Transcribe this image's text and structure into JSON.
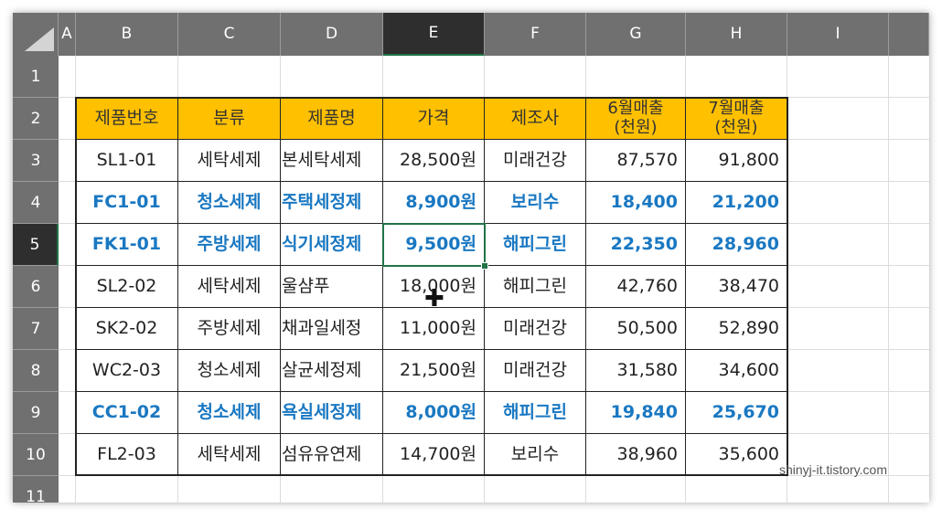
{
  "columns": [
    "A",
    "B",
    "C",
    "D",
    "E",
    "F",
    "G",
    "H",
    "I"
  ],
  "rows": [
    "1",
    "2",
    "3",
    "4",
    "5",
    "6",
    "7",
    "8",
    "9",
    "10",
    "11"
  ],
  "header": [
    "제품번호",
    "분류",
    "제품명",
    "가격",
    "제조사",
    "6월매출\n(천원)",
    "7월매출\n(천원)"
  ],
  "data": [
    {
      "id": "SL1-01",
      "cat": "세탁세제",
      "name": "본세탁세제",
      "price": "28,500원",
      "maker": "미래건강",
      "jun": "87,570",
      "jul": "91,800",
      "highlight": false
    },
    {
      "id": "FC1-01",
      "cat": "청소세제",
      "name": "주택세정제",
      "price": "8,900원",
      "maker": "보리수",
      "jun": "18,400",
      "jul": "21,200",
      "highlight": true
    },
    {
      "id": "FK1-01",
      "cat": "주방세제",
      "name": "식기세정제",
      "price": "9,500원",
      "maker": "해피그린",
      "jun": "22,350",
      "jul": "28,960",
      "highlight": true
    },
    {
      "id": "SL2-02",
      "cat": "세탁세제",
      "name": "울샴푸",
      "price": "18,000원",
      "maker": "해피그린",
      "jun": "42,760",
      "jul": "38,470",
      "highlight": false
    },
    {
      "id": "SK2-02",
      "cat": "주방세제",
      "name": "채과일세정",
      "price": "11,000원",
      "maker": "미래건강",
      "jun": "50,500",
      "jul": "52,890",
      "highlight": false
    },
    {
      "id": "WC2-03",
      "cat": "청소세제",
      "name": "살균세정제",
      "price": "21,500원",
      "maker": "미래건강",
      "jun": "31,580",
      "jul": "34,600",
      "highlight": false
    },
    {
      "id": "CC1-02",
      "cat": "청소세제",
      "name": "욕실세정제",
      "price": "8,000원",
      "maker": "해피그린",
      "jun": "19,840",
      "jul": "25,670",
      "highlight": true
    },
    {
      "id": "FL2-03",
      "cat": "세탁세제",
      "name": "섬유유연제",
      "price": "14,700원",
      "maker": "보리수",
      "jun": "38,960",
      "jul": "35,600",
      "highlight": false
    }
  ],
  "selected": {
    "column": "E",
    "row": "5"
  },
  "watermark": "shinyj-it.tistory.com",
  "colors": {
    "header_fill": "#ffc000",
    "highlight_text": "#1a78c2",
    "selection": "#217346",
    "header_bg": "#707070"
  }
}
